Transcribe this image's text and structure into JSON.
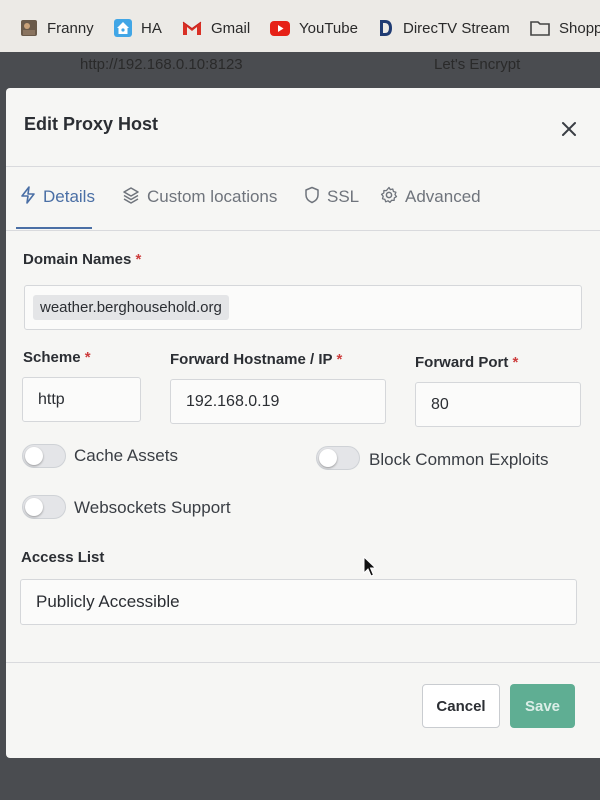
{
  "bookmarks": [
    {
      "label": "Franny",
      "icon": "bookmark-image-icon"
    },
    {
      "label": "HA",
      "icon": "home-assistant-icon"
    },
    {
      "label": "Gmail",
      "icon": "gmail-icon"
    },
    {
      "label": "YouTube",
      "icon": "youtube-icon"
    },
    {
      "label": "DirecTV Stream",
      "icon": "directv-icon"
    },
    {
      "label": "Shopp",
      "icon": "folder-icon"
    }
  ],
  "background": {
    "url_text": "http://192.168.0.10:8123",
    "ssl_text": "Let's Encrypt"
  },
  "modal": {
    "title": "Edit Proxy Host",
    "tabs": [
      {
        "label": "Details",
        "icon": "bolt-icon",
        "active": true
      },
      {
        "label": "Custom locations",
        "icon": "layers-icon",
        "active": false
      },
      {
        "label": "SSL",
        "icon": "shield-icon",
        "active": false
      },
      {
        "label": "Advanced",
        "icon": "gear-icon",
        "active": false
      }
    ],
    "domain_names": {
      "label": "Domain Names",
      "required_mark": "*",
      "values": [
        "weather.berghousehold.org"
      ]
    },
    "scheme": {
      "label": "Scheme",
      "required_mark": "*",
      "value": "http"
    },
    "forward_host": {
      "label": "Forward Hostname / IP",
      "required_mark": "*",
      "value": "192.168.0.19"
    },
    "forward_port": {
      "label": "Forward Port",
      "required_mark": "*",
      "value": "80"
    },
    "toggles": {
      "cache_assets": {
        "label": "Cache Assets",
        "on": false
      },
      "block_exploits": {
        "label": "Block Common Exploits",
        "on": false
      },
      "websockets": {
        "label": "Websockets Support",
        "on": false
      }
    },
    "access_list": {
      "label": "Access List",
      "value": "Publicly Accessible"
    },
    "buttons": {
      "cancel": "Cancel",
      "save": "Save"
    }
  },
  "colors": {
    "accent": "#4a6fa5",
    "required": "#cd3d3d",
    "save_button": "#5fae93"
  }
}
